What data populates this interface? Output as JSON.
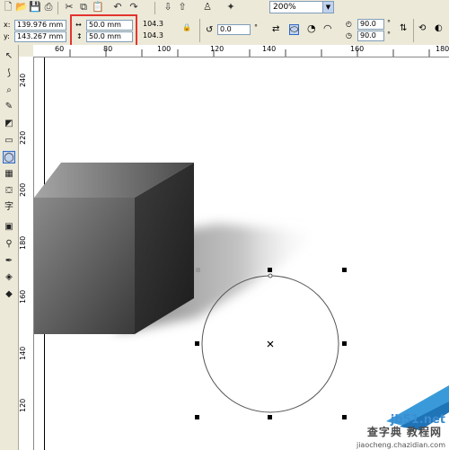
{
  "toolbar1": {
    "zoom_value": "200%",
    "icons": [
      "new-icon",
      "open-icon",
      "save-icon",
      "print-icon",
      "cut-icon",
      "copy-icon",
      "paste-icon",
      "undo-icon",
      "redo-icon",
      "import-icon",
      "export-icon",
      "app-launcher-icon",
      "welcome-icon"
    ]
  },
  "property_bar": {
    "x_label": "x:",
    "x_value": "139.976 mm",
    "y_label": "y:",
    "y_value": "143.267 mm",
    "width_value": "50.0 mm",
    "height_value": "50.0 mm",
    "scale_x": "104.3",
    "scale_y": "104.3",
    "rotation_value": "0.0",
    "degree_symbol": "°",
    "start_angle": "90.0",
    "end_angle": "90.0"
  },
  "ruler_top": {
    "labels": [
      "60",
      "80",
      "100",
      "120",
      "140",
      "160",
      "180"
    ]
  },
  "ruler_left": {
    "labels": [
      "240",
      "220",
      "200",
      "180",
      "160",
      "140",
      "120"
    ]
  },
  "toolbox": {
    "tools": [
      "pick-tool",
      "shape-tool",
      "zoom-tool",
      "freehand-tool",
      "smart-fill-tool",
      "rectangle-tool",
      "ellipse-tool",
      "polygon-tool",
      "basic-shapes-tool",
      "text-tool",
      "interactive-blend-tool",
      "eyedropper-tool",
      "outline-tool",
      "fill-tool",
      "interactive-fill-tool"
    ],
    "active": "ellipse-tool"
  },
  "watermark": {
    "line1": "jb51.net",
    "line2": "查字典 教程网",
    "line3": "jiaocheng.chazidian.com"
  },
  "colors": {
    "highlight": "#e3342f",
    "chrome": "#ece9d8",
    "canvas": "#ffffff"
  }
}
